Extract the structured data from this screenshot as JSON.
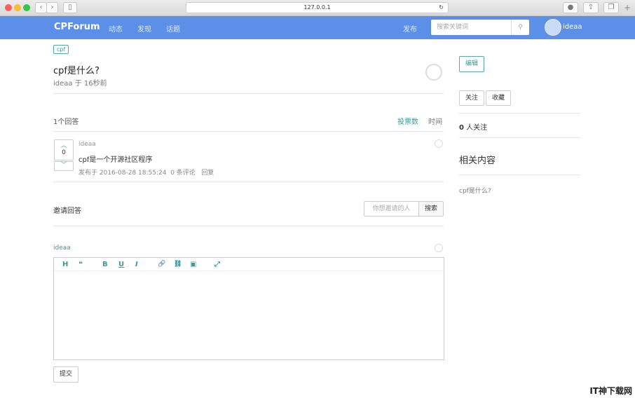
{
  "browser": {
    "url": "127.0.0.1"
  },
  "header": {
    "brand": "CPForum",
    "nav": [
      "动态",
      "发现",
      "话题"
    ],
    "publish": "发布",
    "search_placeholder": "搜索关键词",
    "user": "ideaa"
  },
  "question": {
    "tag": "cpf",
    "title": "cpf是什么?",
    "author": "ideaa",
    "meta": "于 16秒前"
  },
  "answers": {
    "count_label": "1个回答",
    "sort_votes": "投票数",
    "sort_time": "时间",
    "items": [
      {
        "author": "ideaa",
        "votes": "0",
        "content": "cpf是一个开源社区程序",
        "posted": "发布于 2016-08-28 18:55:24",
        "comments": "0 条评论",
        "reply": "回复"
      }
    ]
  },
  "invite": {
    "label": "邀请回答",
    "placeholder": "你想邀请的人",
    "button": "搜索"
  },
  "editor": {
    "user": "ideaa",
    "tools": [
      "H",
      "❝",
      "B",
      "U",
      "I",
      "🔗",
      "⛓",
      "▣",
      "⤢"
    ],
    "submit": "提交"
  },
  "sidebar": {
    "edit": "编辑",
    "follow": "关注",
    "collect": "收藏",
    "followers_count": "0",
    "followers_label": "人关注",
    "related_title": "相关内容",
    "related": [
      "cpf是什么?"
    ]
  },
  "watermark": "IT神下载网"
}
